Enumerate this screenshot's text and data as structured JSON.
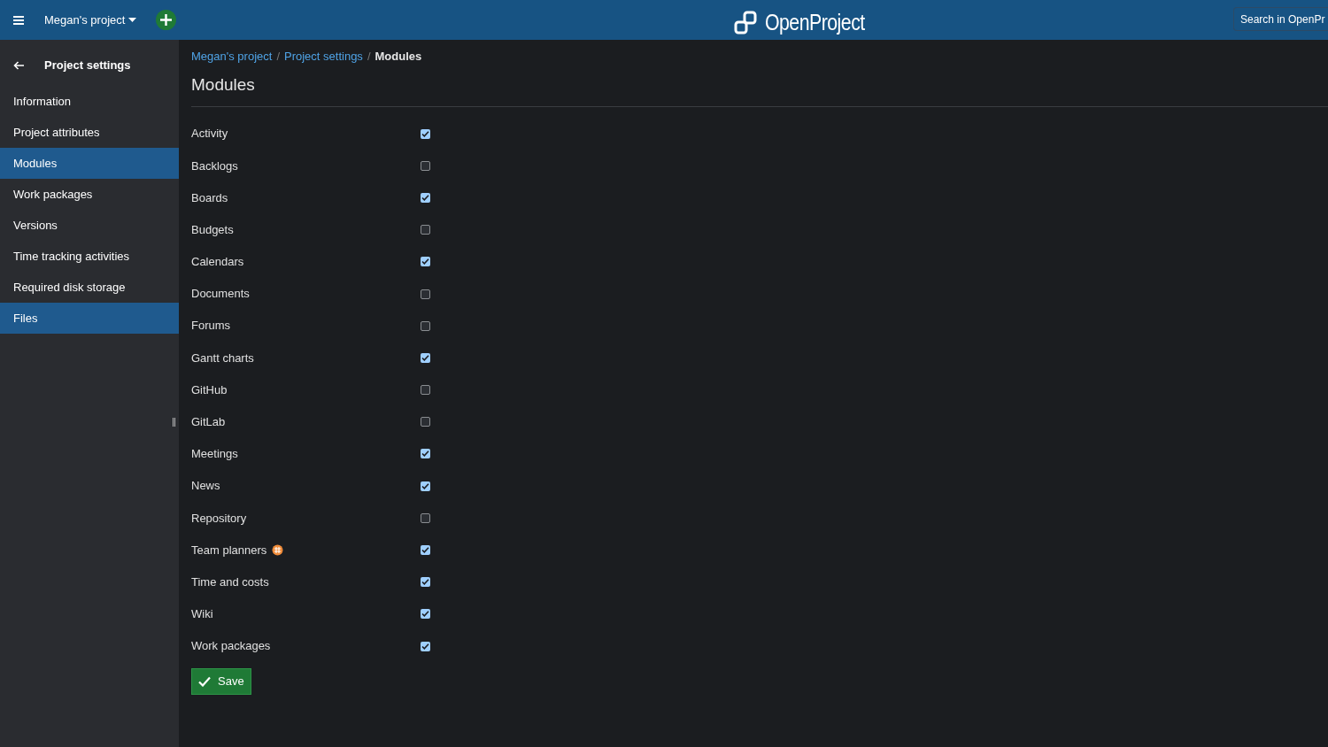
{
  "header": {
    "project": "Megan's project",
    "logo": "OpenProject",
    "search": {
      "placeholder": "Search in OpenPr"
    }
  },
  "sidebar": {
    "title": "Project settings",
    "items": [
      {
        "label": "Information",
        "selected": false
      },
      {
        "label": "Project attributes",
        "selected": false
      },
      {
        "label": "Modules",
        "selected": true
      },
      {
        "label": "Work packages",
        "selected": false
      },
      {
        "label": "Versions",
        "selected": false
      },
      {
        "label": "Time tracking activities",
        "selected": false
      },
      {
        "label": "Required disk storage",
        "selected": false
      },
      {
        "label": "Files",
        "selected": true
      }
    ]
  },
  "breadcrumb_separator": "/",
  "breadcrumb": [
    {
      "label": "Megan's project",
      "current": false
    },
    {
      "label": "Project settings",
      "current": false
    },
    {
      "label": "Modules",
      "current": true
    }
  ],
  "title": "Modules",
  "modules": [
    {
      "label": "Activity",
      "checked": true,
      "enterprise": false
    },
    {
      "label": "Backlogs",
      "checked": false,
      "enterprise": false
    },
    {
      "label": "Boards",
      "checked": true,
      "enterprise": false
    },
    {
      "label": "Budgets",
      "checked": false,
      "enterprise": false
    },
    {
      "label": "Calendars",
      "checked": true,
      "enterprise": false
    },
    {
      "label": "Documents",
      "checked": false,
      "enterprise": false
    },
    {
      "label": "Forums",
      "checked": false,
      "enterprise": false
    },
    {
      "label": "Gantt charts",
      "checked": true,
      "enterprise": false
    },
    {
      "label": "GitHub",
      "checked": false,
      "enterprise": false
    },
    {
      "label": "GitLab",
      "checked": false,
      "enterprise": false
    },
    {
      "label": "Meetings",
      "checked": true,
      "enterprise": false
    },
    {
      "label": "News",
      "checked": true,
      "enterprise": false
    },
    {
      "label": "Repository",
      "checked": false,
      "enterprise": false
    },
    {
      "label": "Team planners",
      "checked": true,
      "enterprise": true
    },
    {
      "label": "Time and costs",
      "checked": true,
      "enterprise": false
    },
    {
      "label": "Wiki",
      "checked": true,
      "enterprise": false
    },
    {
      "label": "Work packages",
      "checked": true,
      "enterprise": false
    }
  ],
  "save_button": "Save"
}
